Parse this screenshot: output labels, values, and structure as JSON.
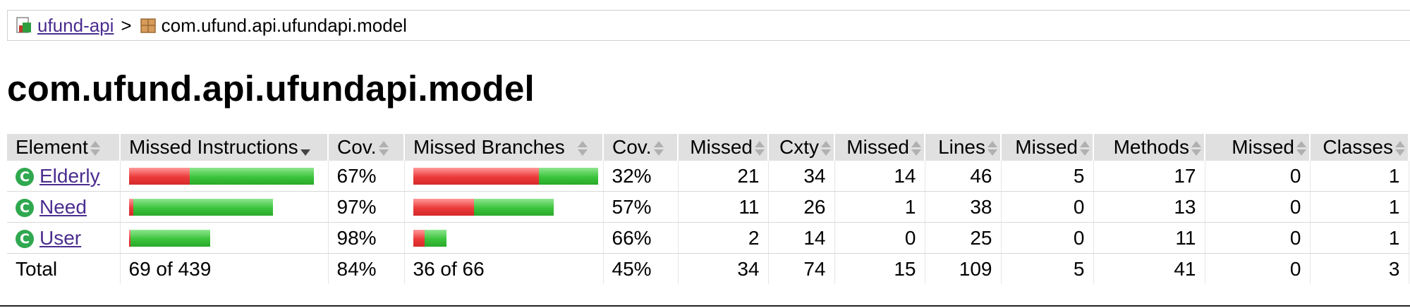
{
  "breadcrumb": {
    "root_label": "ufund-api",
    "separator": ">",
    "package_label": "com.ufund.api.ufundapi.model",
    "root_icon": "report-icon",
    "package_icon": "package-icon"
  },
  "page_title": "com.ufund.api.ufundapi.model",
  "table": {
    "headers": {
      "element": "Element",
      "missed_instructions": "Missed Instructions",
      "cov_instr": "Cov.",
      "missed_branches": "Missed Branches",
      "cov_branch": "Cov.",
      "missed_cxty": "Missed",
      "cxty": "Cxty",
      "missed_lines": "Missed",
      "lines": "Lines",
      "missed_methods": "Missed",
      "methods": "Methods",
      "missed_classes": "Missed",
      "classes": "Classes"
    },
    "class_icon_glyph": "C",
    "rows": [
      {
        "name": "Elderly",
        "instr_missed_frac": 0.33,
        "instr_scale": 1.0,
        "cov_instr": "67%",
        "branch_missed_frac": 0.68,
        "branch_scale": 1.0,
        "cov_branch": "32%",
        "missed_cxty": "21",
        "cxty": "34",
        "missed_lines": "14",
        "lines": "46",
        "missed_methods": "5",
        "methods": "17",
        "missed_classes": "0",
        "classes": "1"
      },
      {
        "name": "Need",
        "instr_missed_frac": 0.03,
        "instr_scale": 0.78,
        "cov_instr": "97%",
        "branch_missed_frac": 0.43,
        "branch_scale": 0.76,
        "cov_branch": "57%",
        "missed_cxty": "11",
        "cxty": "26",
        "missed_lines": "1",
        "lines": "38",
        "missed_methods": "0",
        "methods": "13",
        "missed_classes": "0",
        "classes": "1"
      },
      {
        "name": "User",
        "instr_missed_frac": 0.02,
        "instr_scale": 0.44,
        "cov_instr": "98%",
        "branch_missed_frac": 0.34,
        "branch_scale": 0.18,
        "cov_branch": "66%",
        "missed_cxty": "2",
        "cxty": "14",
        "missed_lines": "0",
        "lines": "25",
        "missed_methods": "0",
        "methods": "11",
        "missed_classes": "0",
        "classes": "1"
      }
    ],
    "total": {
      "label": "Total",
      "missed_instructions": "69 of 439",
      "cov_instr": "84%",
      "missed_branches": "36 of 66",
      "cov_branch": "45%",
      "missed_cxty": "34",
      "cxty": "74",
      "missed_lines": "15",
      "lines": "109",
      "missed_methods": "5",
      "methods": "41",
      "missed_classes": "0",
      "classes": "3"
    }
  },
  "colors": {
    "covered": "#3cc43c",
    "missed": "#ec3a3a",
    "link": "#4b2d8f",
    "header_bg": "#e0e0e0"
  }
}
